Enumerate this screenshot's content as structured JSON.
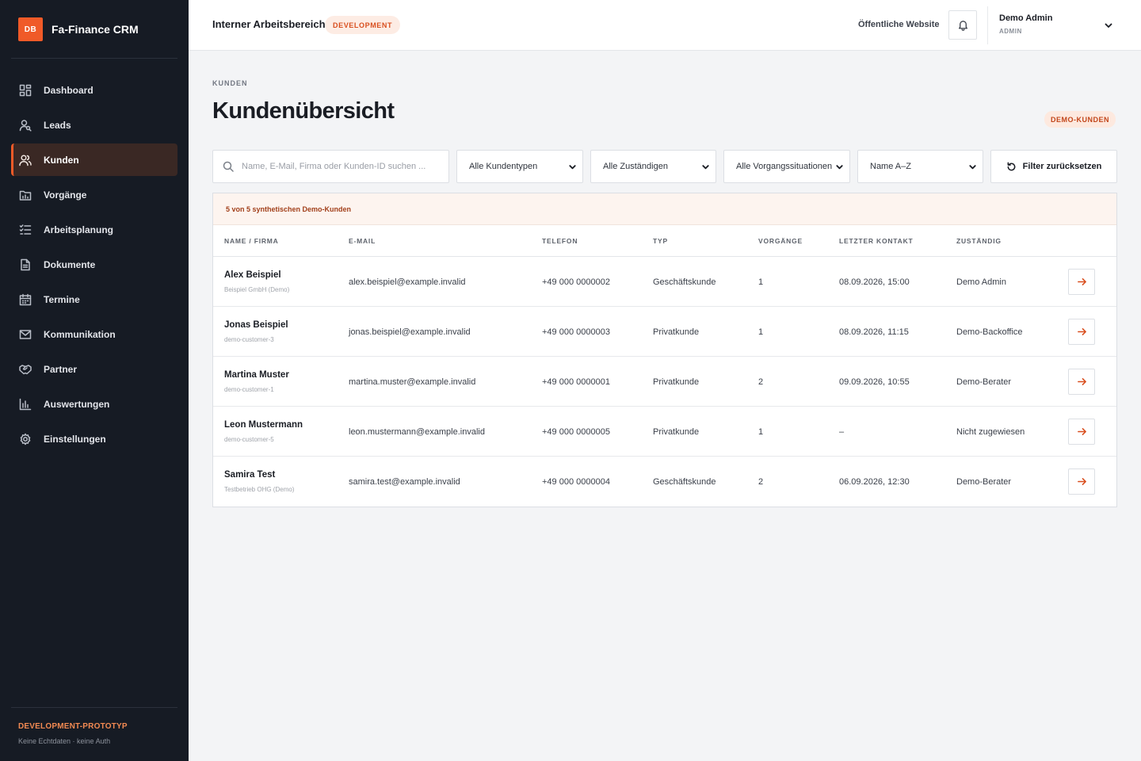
{
  "sidebar": {
    "brand_badge": "DB",
    "brand_name": "Fa-Finance CRM",
    "items": [
      {
        "label": "Dashboard",
        "icon": "dashboard-icon"
      },
      {
        "label": "Leads",
        "icon": "user-search-icon"
      },
      {
        "label": "Kunden",
        "icon": "users-icon",
        "active": true
      },
      {
        "label": "Vorgänge",
        "icon": "folder-chart-icon"
      },
      {
        "label": "Arbeitsplanung",
        "icon": "checklist-icon"
      },
      {
        "label": "Dokumente",
        "icon": "document-icon"
      },
      {
        "label": "Termine",
        "icon": "calendar-icon"
      },
      {
        "label": "Kommunikation",
        "icon": "mail-icon"
      },
      {
        "label": "Partner",
        "icon": "handshake-icon"
      },
      {
        "label": "Auswertungen",
        "icon": "bar-chart-icon"
      },
      {
        "label": "Einstellungen",
        "icon": "gear-icon"
      }
    ],
    "footer_title": "DEVELOPMENT-PROTOTYP",
    "footer_sub": "Keine Echtdaten · keine Auth"
  },
  "topbar": {
    "title": "Interner Arbeitsbereich",
    "env_badge": "DEVELOPMENT",
    "website_link": "Öffentliche Website",
    "user_name": "Demo Admin",
    "user_role": "ADMIN"
  },
  "main": {
    "breadcrumb": "KUNDEN",
    "title": "Kundenübersicht",
    "badge": "DEMO-KUNDEN",
    "filters": {
      "search_placeholder": "Name, E-Mail, Firma oder Kunden-ID suchen ...",
      "type": "Alle Kundentypen",
      "owner": "Alle Zuständigen",
      "situation": "Alle Vorgangssituationen",
      "sort": "Name A–Z",
      "reset": "Filter zurücksetzen"
    },
    "count_text": "5 von 5 synthetischen Demo-Kunden",
    "columns": [
      "NAME / FIRMA",
      "E-MAIL",
      "TELEFON",
      "TYP",
      "VORGÄNGE",
      "LETZTER KONTAKT",
      "ZUSTÄNDIG"
    ],
    "rows": [
      {
        "name": "Alex Beispiel",
        "sub": "Beispiel GmbH (Demo)",
        "email": "alex.beispiel@example.invalid",
        "phone": "+49 000 0000002",
        "type": "Geschäftskunde",
        "cases": "1",
        "last_contact": "08.09.2026, 15:00",
        "owner": "Demo Admin"
      },
      {
        "name": "Jonas Beispiel",
        "sub": "demo-customer-3",
        "email": "jonas.beispiel@example.invalid",
        "phone": "+49 000 0000003",
        "type": "Privatkunde",
        "cases": "1",
        "last_contact": "08.09.2026, 11:15",
        "owner": "Demo-Backoffice"
      },
      {
        "name": "Martina Muster",
        "sub": "demo-customer-1",
        "email": "martina.muster@example.invalid",
        "phone": "+49 000 0000001",
        "type": "Privatkunde",
        "cases": "2",
        "last_contact": "09.09.2026, 10:55",
        "owner": "Demo-Berater"
      },
      {
        "name": "Leon Mustermann",
        "sub": "demo-customer-5",
        "email": "leon.mustermann@example.invalid",
        "phone": "+49 000 0000005",
        "type": "Privatkunde",
        "cases": "1",
        "last_contact": "–",
        "owner": "Nicht zugewiesen"
      },
      {
        "name": "Samira Test",
        "sub": "Testbetrieb OHG (Demo)",
        "email": "samira.test@example.invalid",
        "phone": "+49 000 0000004",
        "type": "Geschäftskunde",
        "cases": "2",
        "last_contact": "06.09.2026, 12:30",
        "owner": "Demo-Berater"
      }
    ]
  },
  "colors": {
    "accent": "#f05a28",
    "sidebar_bg": "#161b24",
    "page_bg": "#f3f4f6"
  }
}
